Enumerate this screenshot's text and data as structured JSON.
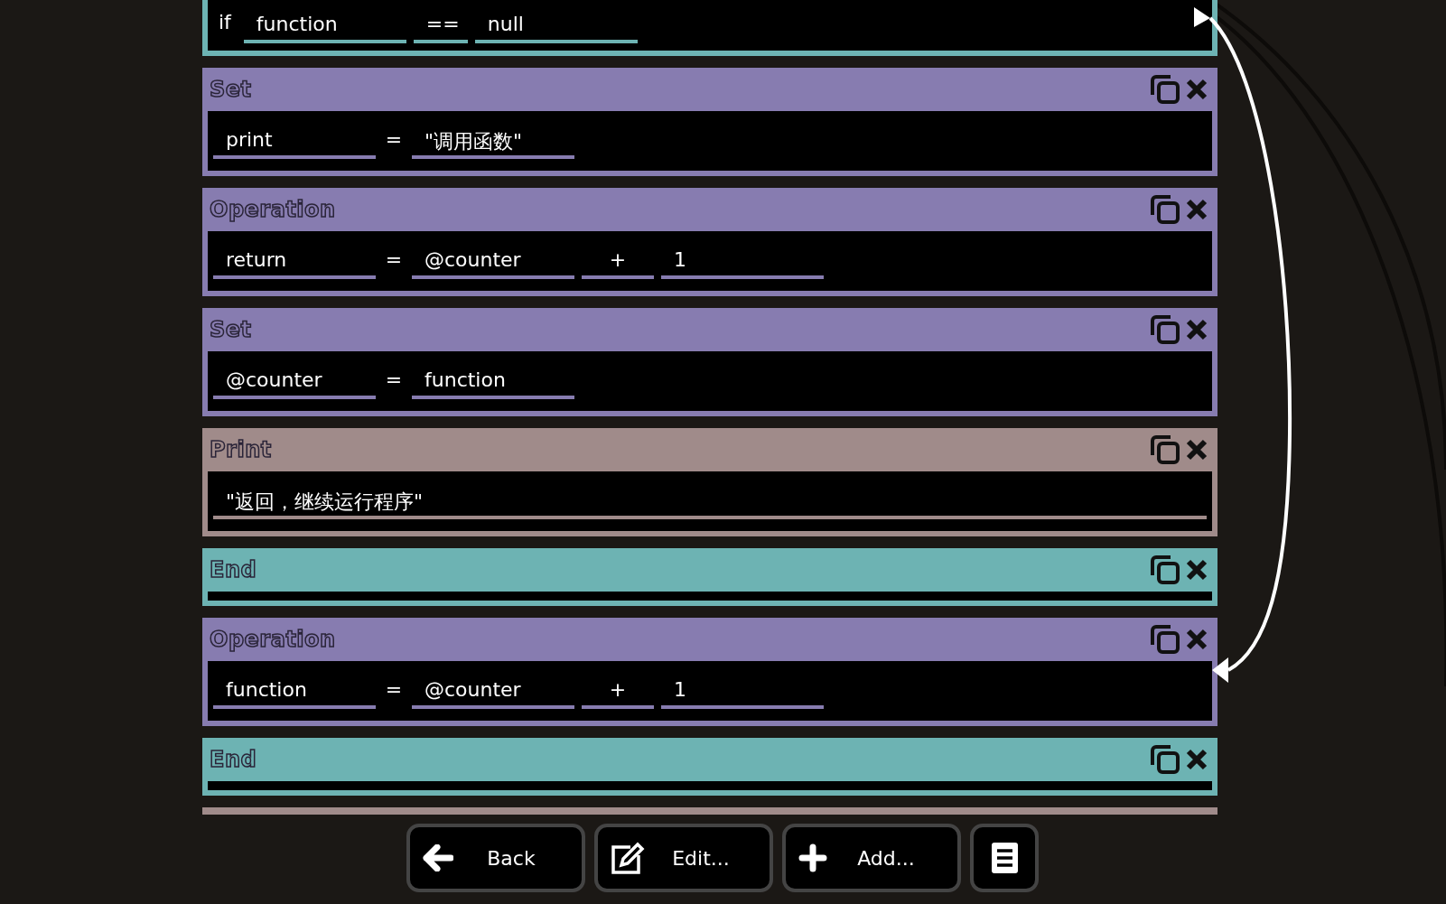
{
  "blocks": [
    {
      "kind": "if",
      "color": "#6db3b3",
      "label": "if",
      "fields": [
        {
          "kind": "field",
          "text": "function"
        },
        {
          "kind": "op",
          "text": "=="
        },
        {
          "kind": "field",
          "text": "null"
        }
      ]
    },
    {
      "kind": "set",
      "color": "#877cb0",
      "title": "Set",
      "fields": [
        {
          "kind": "field",
          "text": "print"
        },
        {
          "kind": "symbol",
          "text": "="
        },
        {
          "kind": "field",
          "text": "\"调用函数\""
        }
      ]
    },
    {
      "kind": "set",
      "color": "#877cb0",
      "title": "Operation",
      "fields": [
        {
          "kind": "field",
          "text": "return"
        },
        {
          "kind": "symbol",
          "text": "="
        },
        {
          "kind": "field",
          "text": "@counter"
        },
        {
          "kind": "op",
          "text": "+"
        },
        {
          "kind": "field",
          "text": "1"
        }
      ]
    },
    {
      "kind": "set",
      "color": "#877cb0",
      "title": "Set",
      "fields": [
        {
          "kind": "field",
          "text": "@counter"
        },
        {
          "kind": "symbol",
          "text": "="
        },
        {
          "kind": "field",
          "text": "function"
        }
      ]
    },
    {
      "kind": "print",
      "color": "#a08b8a",
      "title": "Print",
      "fields": [
        {
          "kind": "wide",
          "text": "\"返回，继续运行程序\""
        }
      ]
    },
    {
      "kind": "end",
      "color": "#6db3b3",
      "title": "End"
    },
    {
      "kind": "set",
      "color": "#877cb0",
      "title": "Operation",
      "fields": [
        {
          "kind": "field",
          "text": "function"
        },
        {
          "kind": "symbol",
          "text": "="
        },
        {
          "kind": "field",
          "text": "@counter"
        },
        {
          "kind": "op",
          "text": "+"
        },
        {
          "kind": "field",
          "text": "1"
        }
      ]
    },
    {
      "kind": "end",
      "color": "#6db3b3",
      "title": "End"
    },
    {
      "kind": "stub",
      "color": "#a08b8a"
    }
  ],
  "buttons": [
    {
      "kind": "back",
      "label": "Back"
    },
    {
      "kind": "edit",
      "label": "Edit..."
    },
    {
      "kind": "add",
      "label": "Add..."
    },
    {
      "kind": "list"
    }
  ]
}
